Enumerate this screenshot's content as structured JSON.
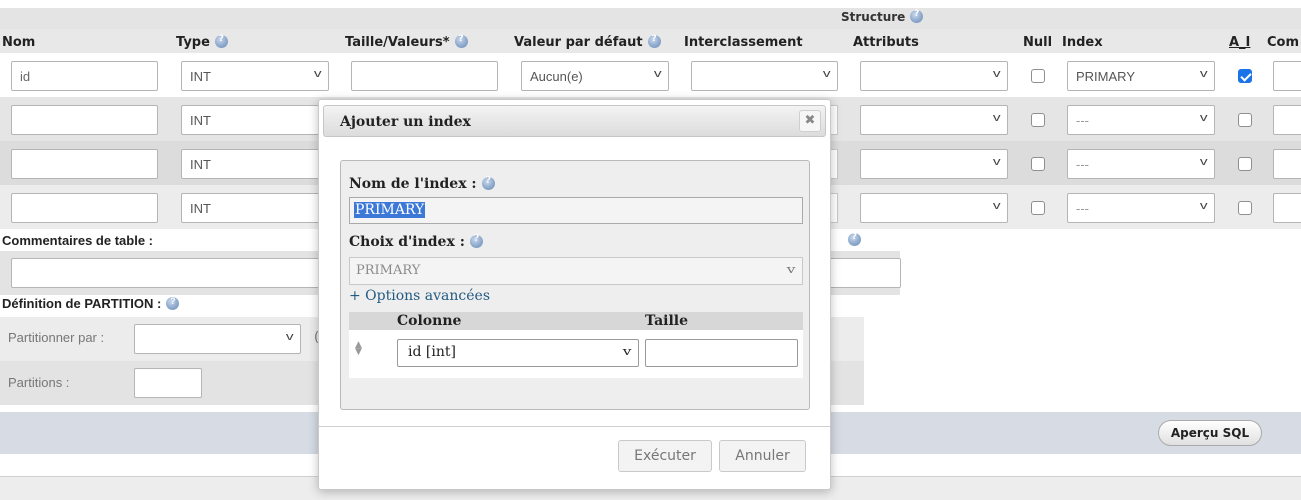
{
  "structure_label": "Structure",
  "columns": {
    "nom": "Nom",
    "type": "Type",
    "taille": "Taille/Valeurs*",
    "defaut": "Valeur par défaut",
    "interclassement": "Interclassement",
    "attributs": "Attributs",
    "null": "Null",
    "index": "Index",
    "ai": "A_I",
    "com": "Com"
  },
  "rows": [
    {
      "name": "id",
      "type": "INT",
      "default": "Aucun(e)",
      "index": "PRIMARY",
      "null": false,
      "ai": true
    },
    {
      "name": "",
      "type": "INT",
      "default": "",
      "index": "---",
      "null": false,
      "ai": false
    },
    {
      "name": "",
      "type": "INT",
      "default": "",
      "index": "---",
      "null": false,
      "ai": false
    },
    {
      "name": "",
      "type": "INT",
      "default": "",
      "index": "---",
      "null": false,
      "ai": false
    }
  ],
  "table_comments_label": "Commentaires de table :",
  "partition": {
    "title": "Définition de PARTITION :",
    "by_label": "Partitionner par :",
    "open_paren": "(",
    "partitions_label": "Partitions :"
  },
  "preview_sql_label": "Aperçu SQL",
  "dialog": {
    "title": "Ajouter un index",
    "close_glyph": "✖",
    "index_name_label": "Nom de l'index :",
    "index_name_value": "PRIMARY",
    "index_choice_label": "Choix d'index :",
    "index_choice_value": "PRIMARY",
    "advanced_link": "+ Options avancées",
    "col_header": "Colonne",
    "size_header": "Taille",
    "column_value": "id [int]",
    "size_value": "",
    "execute_label": "Exécuter",
    "cancel_label": "Annuler"
  }
}
